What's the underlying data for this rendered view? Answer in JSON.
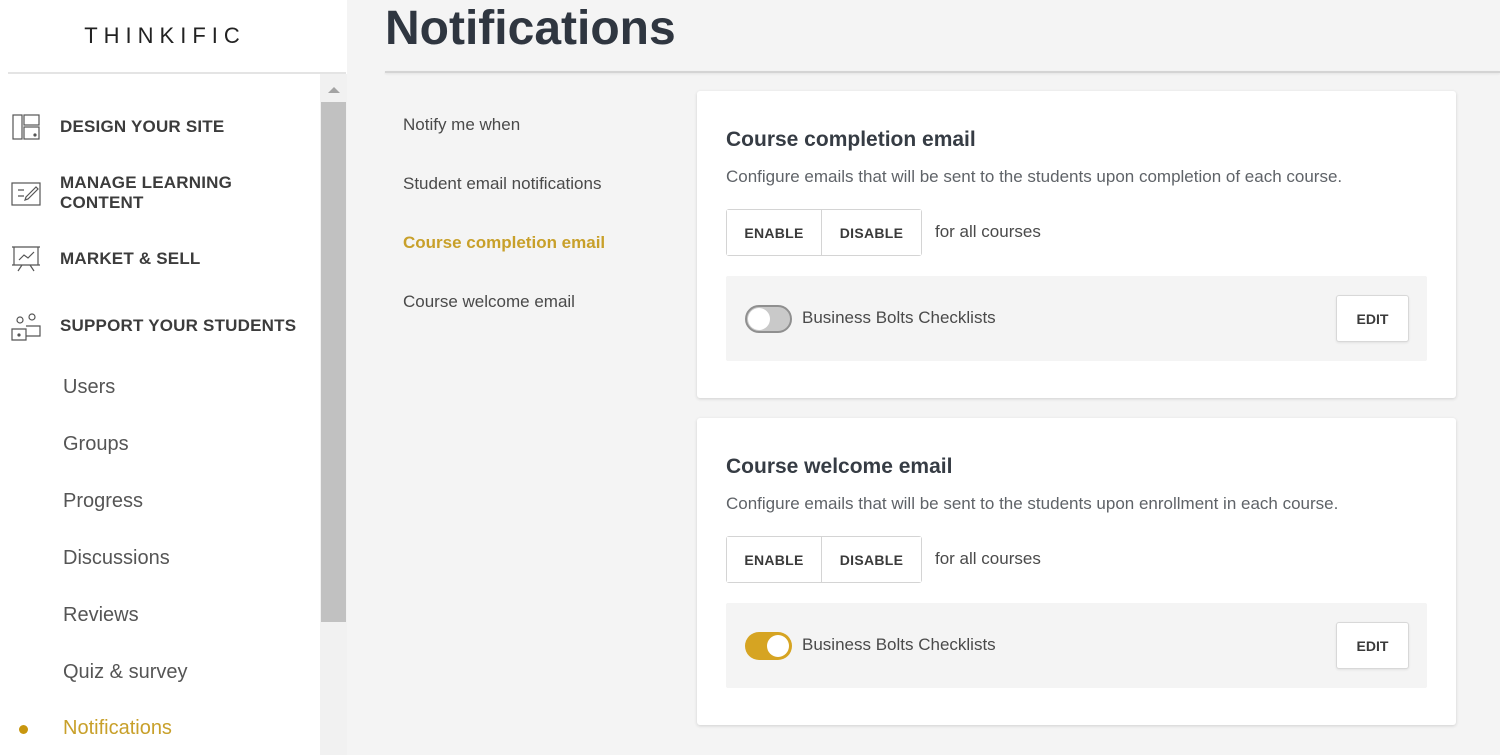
{
  "brand": {
    "logo_text": "THINKIFIC"
  },
  "colors": {
    "accent": "#c8a02a",
    "toggle_on": "#d6a422",
    "toggle_off": "#c9c9c9"
  },
  "sidebar": {
    "sections": [
      {
        "label": "DESIGN YOUR SITE",
        "icon": "layout-icon"
      },
      {
        "label": "MANAGE LEARNING CONTENT",
        "icon": "edit-content-icon"
      },
      {
        "label": "MARKET & SELL",
        "icon": "presentation-chart-icon"
      },
      {
        "label": "SUPPORT YOUR STUDENTS",
        "icon": "students-icon"
      }
    ],
    "sub_items": [
      {
        "label": "Users",
        "active": false
      },
      {
        "label": "Groups",
        "active": false
      },
      {
        "label": "Progress",
        "active": false
      },
      {
        "label": "Discussions",
        "active": false
      },
      {
        "label": "Reviews",
        "active": false
      },
      {
        "label": "Quiz & survey",
        "active": false
      },
      {
        "label": "Notifications",
        "active": true
      }
    ]
  },
  "main": {
    "title": "Notifications",
    "subnav": [
      {
        "label": "Notify me when",
        "active": false
      },
      {
        "label": "Student email notifications",
        "active": false
      },
      {
        "label": "Course completion email",
        "active": true
      },
      {
        "label": "Course welcome email",
        "active": false
      }
    ],
    "cards": [
      {
        "title": "Course completion email",
        "description": "Configure emails that will be sent to the students upon completion of each course.",
        "enable_label": "ENABLE",
        "disable_label": "DISABLE",
        "scope_text": "for all courses",
        "course_name": "Business Bolts Checklists",
        "toggle_on": false,
        "edit_label": "EDIT"
      },
      {
        "title": "Course welcome email",
        "description": "Configure emails that will be sent to the students upon enrollment in each course.",
        "enable_label": "ENABLE",
        "disable_label": "DISABLE",
        "scope_text": "for all courses",
        "course_name": "Business Bolts Checklists",
        "toggle_on": true,
        "edit_label": "EDIT"
      }
    ]
  }
}
